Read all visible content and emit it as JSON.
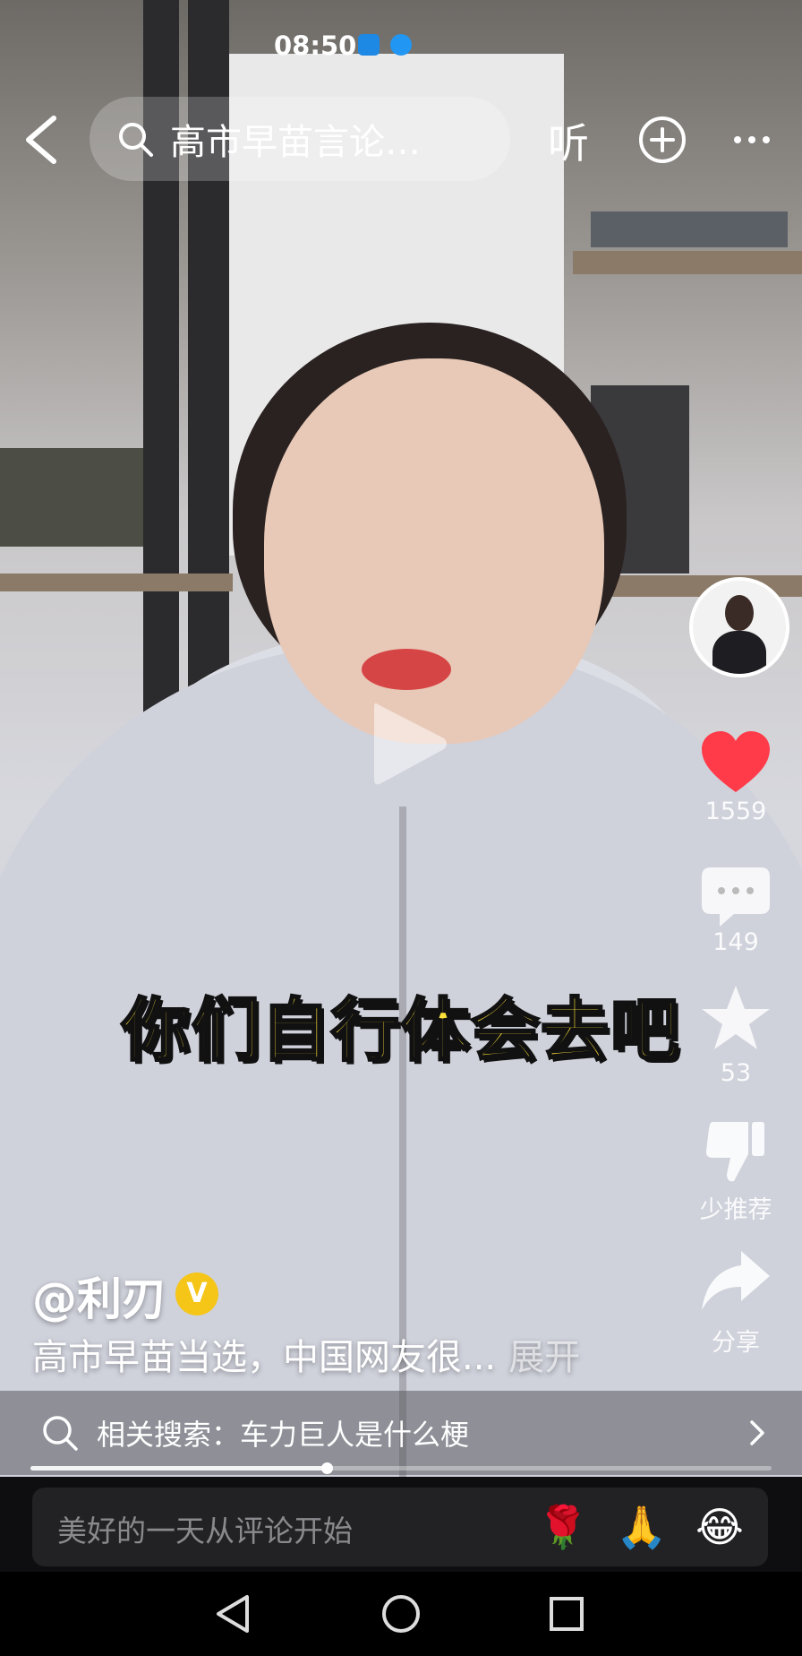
{
  "status_bar": {
    "time": "08:50"
  },
  "top_bar": {
    "search_text": "高市早苗言论…",
    "listen_label": "听"
  },
  "caption": "你们自行体会去吧",
  "right_rail": {
    "like_count": "1559",
    "comment_count": "149",
    "favorite_count": "53",
    "dislike_label": "少推荐",
    "share_label": "分享"
  },
  "video_info": {
    "author": "@利刃",
    "verified_badge": "V",
    "description": "高市早苗当选，中国网友很...",
    "expand_label": "展开"
  },
  "related_search": {
    "text": "相关搜索：车力巨人是什么梗"
  },
  "progress": {
    "fraction": 0.4
  },
  "comment_bar": {
    "placeholder": "美好的一天从评论开始",
    "emojis": [
      "🌹",
      "🙏",
      "😂"
    ]
  },
  "colors": {
    "like": "#ff3b4a",
    "caption": "#ffe23a",
    "verified": "#f5c518"
  }
}
